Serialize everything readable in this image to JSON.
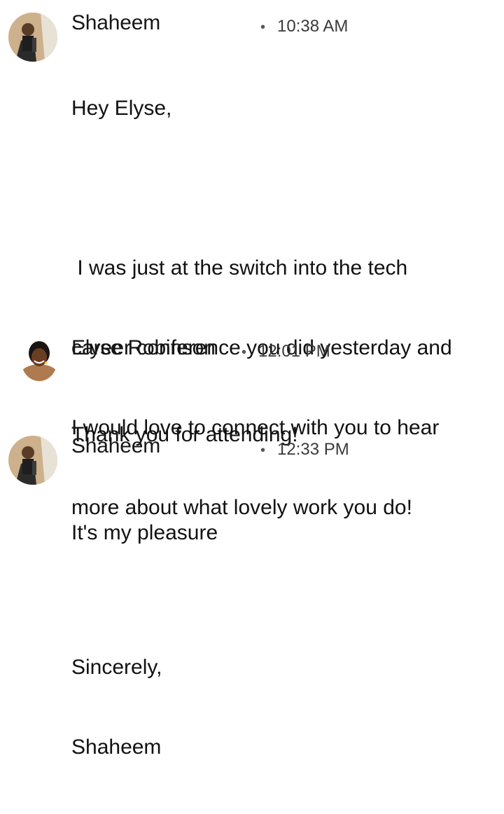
{
  "messages": [
    {
      "sender": "Shaheem",
      "time": "10:38 AM",
      "separator": "•",
      "avatar_icon": "profile-photo-shaheem",
      "lines": [
        "Hey Elyse,",
        "",
        " I was just at the switch into the tech",
        "career conference you did yesterday and",
        "I would love to connect with you to hear",
        "more about what lovely work you do!",
        "",
        "Sincerely,",
        "Shaheem"
      ]
    },
    {
      "sender": "Elyse Robinson",
      "time": "12:01 PM",
      "separator": "•",
      "avatar_icon": "profile-photo-elyse",
      "lines": [
        "Thank you for attending!"
      ]
    },
    {
      "sender": "Shaheem",
      "time": "12:33 PM",
      "separator": "•",
      "avatar_icon": "profile-photo-shaheem",
      "lines": [
        "It's my pleasure"
      ]
    }
  ]
}
